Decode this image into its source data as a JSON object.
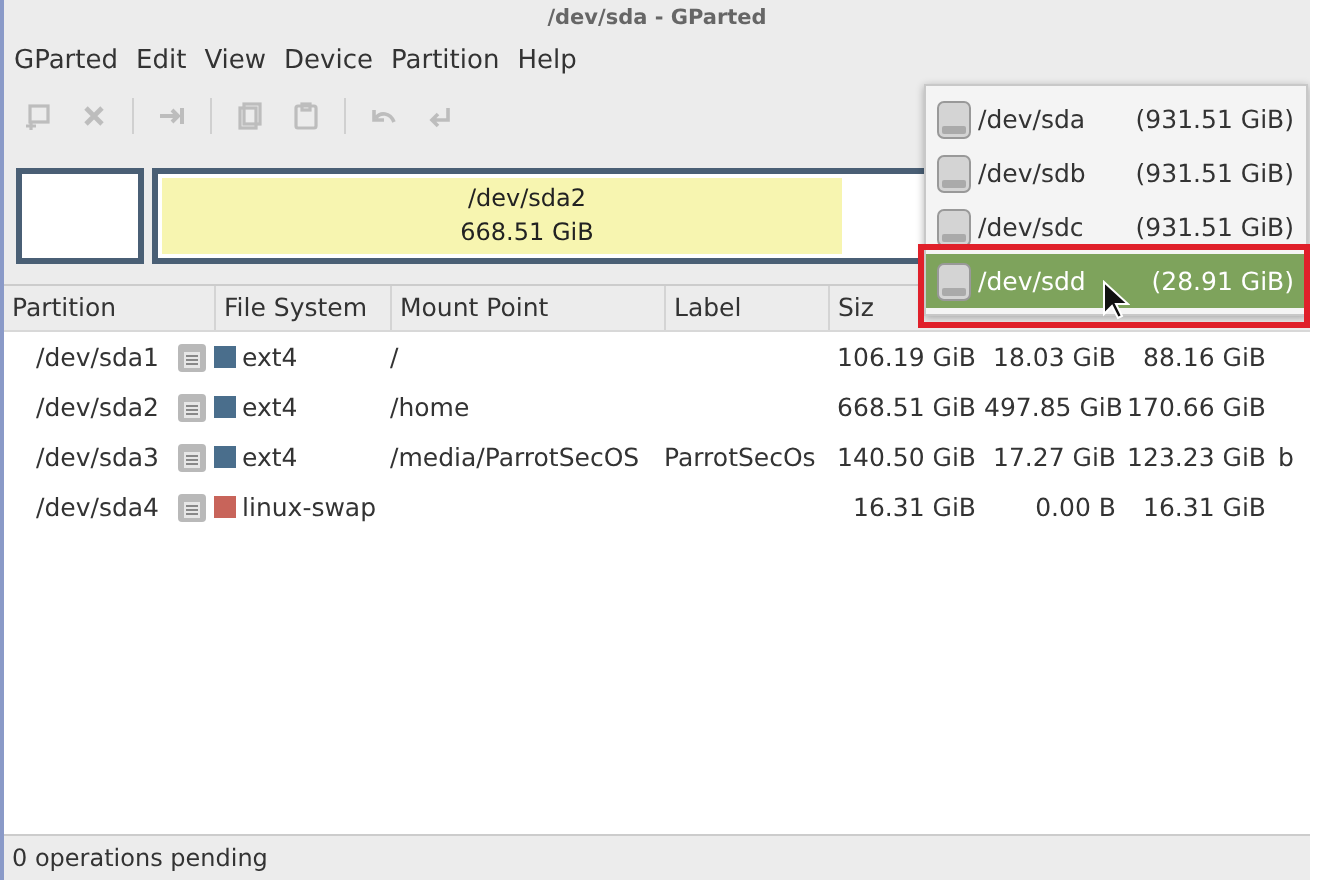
{
  "window": {
    "title": "/dev/sda - GParted"
  },
  "menu": [
    "GParted",
    "Edit",
    "View",
    "Device",
    "Partition",
    "Help"
  ],
  "toolbar": [
    {
      "kind": "new",
      "disabled": true
    },
    {
      "kind": "delete",
      "disabled": true
    },
    {
      "kind": "sep"
    },
    {
      "kind": "resize",
      "disabled": true
    },
    {
      "kind": "sep"
    },
    {
      "kind": "copy",
      "disabled": true
    },
    {
      "kind": "paste",
      "disabled": true
    },
    {
      "kind": "sep"
    },
    {
      "kind": "undo",
      "disabled": true
    },
    {
      "kind": "apply",
      "disabled": true
    }
  ],
  "disk_map": {
    "partitions": [
      {
        "color": "#ffffff",
        "selected": false
      },
      {
        "name": "/dev/sda2",
        "size": "668.51 GiB",
        "color": "#f7f5b0",
        "selected": false
      }
    ]
  },
  "table": {
    "columns": [
      "Partition",
      "File System",
      "Mount Point",
      "Label",
      "Siz"
    ],
    "rows": [
      {
        "partition": "/dev/sda1",
        "filesystem": "ext4",
        "color": "#4a6e8c",
        "mount_point": "/",
        "label": "",
        "size": "106.19 GiB",
        "used": "18.03 GiB",
        "unused": "88.16 GiB",
        "flags": ""
      },
      {
        "partition": "/dev/sda2",
        "filesystem": "ext4",
        "color": "#4a6e8c",
        "mount_point": "/home",
        "label": "",
        "size": "668.51 GiB",
        "used": "497.85 GiB",
        "unused": "170.66 GiB",
        "flags": ""
      },
      {
        "partition": "/dev/sda3",
        "filesystem": "ext4",
        "color": "#4a6e8c",
        "mount_point": "/media/ParrotSecOS",
        "label": "ParrotSecOs",
        "size": "140.50 GiB",
        "used": "17.27 GiB",
        "unused": "123.23 GiB",
        "flags": "b"
      },
      {
        "partition": "/dev/sda4",
        "filesystem": "linux-swap",
        "color": "#c8645a",
        "mount_point": "",
        "label": "",
        "size": "16.31 GiB",
        "used": "0.00 B",
        "unused": "16.31 GiB",
        "flags": ""
      }
    ]
  },
  "device_menu": [
    {
      "name": "/dev/sda",
      "size": "(931.51 GiB)",
      "selected": false
    },
    {
      "name": "/dev/sdb",
      "size": "(931.51 GiB)",
      "selected": false
    },
    {
      "name": "/dev/sdc",
      "size": "(931.51 GiB)",
      "selected": false
    },
    {
      "name": "/dev/sdd",
      "size": "(28.91 GiB)",
      "selected": true
    }
  ],
  "status_bar": "0 operations pending"
}
